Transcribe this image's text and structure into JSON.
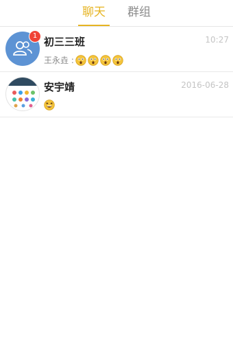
{
  "tabs": [
    {
      "label": "聊天",
      "active": true
    },
    {
      "label": "群组",
      "active": false
    }
  ],
  "conversations": [
    {
      "name": "初三三班",
      "time": "10:27",
      "badge": "1",
      "sender": "王永垚 :",
      "avatar_icon": "group-icon",
      "emoji_icon": "astonished-face-emoji",
      "emoji_count": 4
    },
    {
      "name": "安宇靖",
      "time": "2016-06-28",
      "sender": "",
      "avatar_icon": "app-grid-avatar",
      "emoji_icon": "grinning-squint-emoji",
      "emoji_count": 1
    }
  ],
  "colors": {
    "accent": "#e6b422",
    "badge": "#f04336",
    "group_avatar": "#5d93d4"
  }
}
